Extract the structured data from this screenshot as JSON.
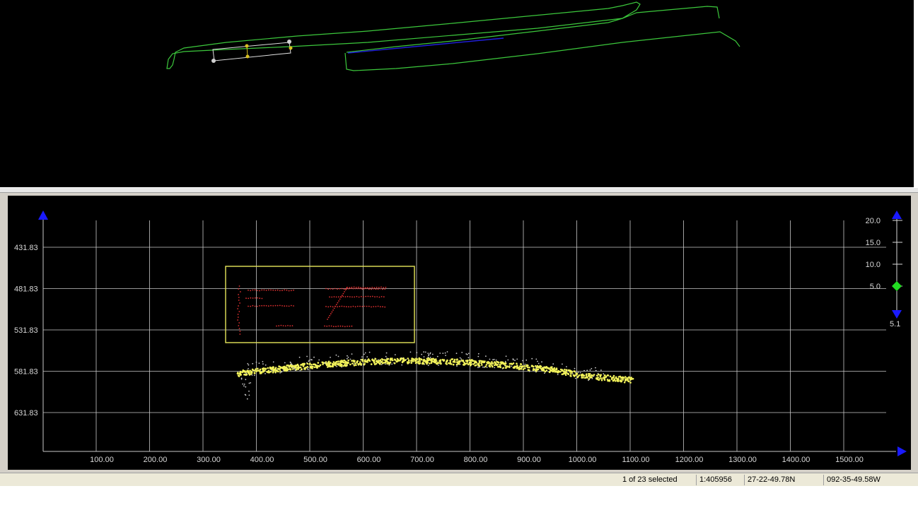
{
  "profile": {
    "y_labels": [
      "431.83",
      "481.83",
      "531.83",
      "581.83",
      "631.83"
    ],
    "x_labels": [
      "100.00",
      "200.00",
      "300.00",
      "400.00",
      "500.00",
      "600.00",
      "700.00",
      "800.00",
      "900.00",
      "1000.00",
      "1100.00",
      "1200.00",
      "1300.00",
      "1400.00",
      "1500.00"
    ],
    "colors": {
      "grid": "#c8c8c8",
      "selection_box": "#e6e65a",
      "selected_points": "#e03030",
      "bottom_points": "#f2f25a",
      "scatter_points": "#c8c8c8",
      "arrows": "#1a1aff",
      "scale_marker": "#22dd22"
    }
  },
  "scale_slider": {
    "ticks": [
      "20.0",
      "15.0",
      "10.0",
      "5.0"
    ],
    "value": "5.1"
  },
  "map": {
    "colors": {
      "track": "#3cc83c",
      "active_line": "#2020dd",
      "selection": "#e0e0e0",
      "handles": "#d8c020"
    }
  },
  "status_bar": {
    "selection": "1 of 23 selected",
    "scale": "1:405956",
    "latitude": "27-22-49.78N",
    "longitude": "092-35-49.58W"
  }
}
